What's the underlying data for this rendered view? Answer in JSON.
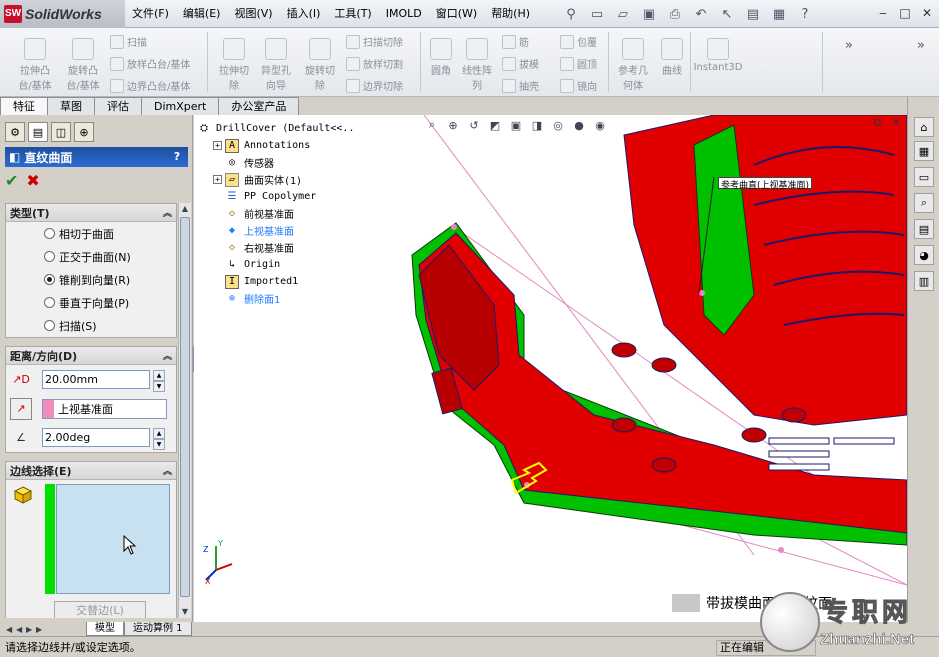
{
  "app": {
    "logo_prefix": "SW",
    "name": "SolidWorks"
  },
  "menu": [
    "文件(F)",
    "编辑(E)",
    "视图(V)",
    "插入(I)",
    "工具(T)",
    "IMOLD",
    "窗口(W)",
    "帮助(H)"
  ],
  "ribbon": {
    "extrude_boss": "拉伸凸\n台/基体",
    "revolve_boss": "旋转凸\n台/基体",
    "sweep": "扫描",
    "loft_boss": "放样凸台/基体",
    "boundary_boss": "边界凸台/基体",
    "extrude_cut": "拉伸切\n除",
    "hole_wizard": "异型孔\n向导",
    "revolve_cut": "旋转切\n除",
    "swept_cut": "扫描切除",
    "lofted_cut": "放样切割",
    "boundary_cut": "边界切除",
    "fillet": "圆角",
    "linear_pattern": "线性阵\n列",
    "rib": "筋",
    "draft": "拔模",
    "shell": "抽壳",
    "wrap": "包覆",
    "dome": "圆顶",
    "mirror": "镜向",
    "ref_geometry": "参考几\n何体",
    "curves": "曲线",
    "instant3d": "Instant3D"
  },
  "cm_tabs": [
    "特征",
    "草图",
    "评估",
    "DimXpert",
    "办公室产品"
  ],
  "property_manager": {
    "title": "直纹曲面",
    "help": "?",
    "ok": "✔",
    "cancel": "✖",
    "type_group": {
      "title": "类型(T)",
      "options": [
        {
          "label": "相切于曲面",
          "selected": false
        },
        {
          "label": "正交于曲面(N)",
          "selected": false
        },
        {
          "label": "锥削到向量(R)",
          "selected": true
        },
        {
          "label": "垂直于向量(P)",
          "selected": false
        },
        {
          "label": "扫描(S)",
          "selected": false
        }
      ]
    },
    "distance_group": {
      "title": "距离/方向(D)",
      "distance": "20.00mm",
      "reference": "上视基准面",
      "angle": "2.00deg"
    },
    "edge_group": {
      "title": "边线选择(E)",
      "alternate_button": "交替边(L)"
    }
  },
  "tree": {
    "root": "DrillCover  (Default<<..",
    "items": [
      {
        "label": "Annotations",
        "icon": "annotation-icon",
        "expandable": true,
        "style": "normal"
      },
      {
        "label": "传感器",
        "icon": "sensor-icon",
        "expandable": false,
        "style": "normal"
      },
      {
        "label": "曲面实体(1)",
        "icon": "surface-bodies-icon",
        "expandable": true,
        "style": "normal"
      },
      {
        "label": "PP Copolymer",
        "icon": "material-icon",
        "expandable": false,
        "style": "normal"
      },
      {
        "label": "前视基准面",
        "icon": "plane-icon",
        "expandable": false,
        "style": "normal"
      },
      {
        "label": "上视基准面",
        "icon": "plane-icon",
        "expandable": false,
        "style": "selected"
      },
      {
        "label": "右视基准面",
        "icon": "plane-icon",
        "expandable": false,
        "style": "normal"
      },
      {
        "label": "Origin",
        "icon": "origin-icon",
        "expandable": false,
        "style": "normal"
      },
      {
        "label": "Imported1",
        "icon": "imported-icon",
        "expandable": false,
        "style": "normal"
      },
      {
        "label": "删除面1",
        "icon": "delete-face-icon",
        "expandable": false,
        "style": "selected"
      }
    ]
  },
  "graphics": {
    "callout": "参考曲直(上视基准面)",
    "caption": "带拔模曲面的直纹面"
  },
  "bottom_tabs": [
    "模型",
    "运动算例 1"
  ],
  "status": {
    "message": "请选择边线并/或设定选项。",
    "editing": "正在编辑"
  },
  "watermark": {
    "chinese": "专职网",
    "url": "Zhuanzhi.Net"
  },
  "colors": {
    "model_red": "#e00000",
    "model_green": "#00c000",
    "edge_green": "#00e000",
    "edge_list_bg": "#c8e1f0",
    "selection_blue": "#1e7bff"
  }
}
